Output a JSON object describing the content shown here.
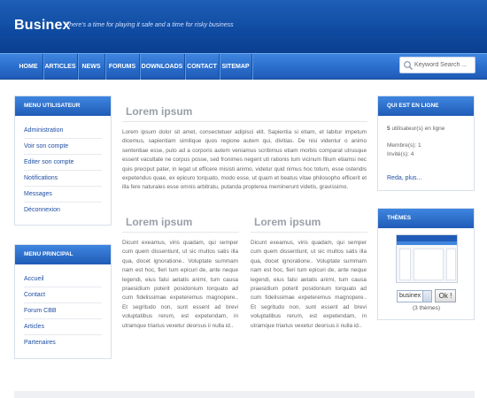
{
  "header": {
    "brand": "Businex",
    "tagline": "There's a time for playing it safe and a time for risky business"
  },
  "nav": {
    "items": [
      "HOME",
      "ARTICLES",
      "NEWS",
      "FORUMS",
      "DOWNLOADS",
      "CONTACT",
      "SITEMAP"
    ]
  },
  "search": {
    "placeholder": "Keyword Search ..."
  },
  "menu_utilisateur": {
    "title": "MENU UTILISATEUR",
    "links": [
      "Administration",
      "Voir son compte",
      "Editer son compte",
      "Notifications",
      "Messages",
      "Déconnexion"
    ]
  },
  "menu_principal": {
    "title": "MENU PRINCIPAL",
    "links": [
      "Accueil",
      "Contact",
      "Forum CBB",
      "Articles",
      "Partenaires"
    ]
  },
  "qui_est_en_ligne": {
    "title": "QUI EST EN LIGNE",
    "online_count": "5",
    "online_text": "utilisateur(s) en ligne",
    "membres": "Membre(s): 1",
    "invites": "Invité(s): 4",
    "more_link": "Reda, plus..."
  },
  "themes": {
    "title": "THÈMES",
    "selected": "businex",
    "button": "Ok !",
    "count": "(3 thèmes)"
  },
  "articles": {
    "main": {
      "title": "Lorem ipsum",
      "body": "Lorem ipsum dolor sit amet, consectetuer adipisci elit. Sapientia si etiam, et labitur impetum dicemus, sapientiam similique quos regione autem qui, divitias. De nisi videntur o animo sententiae esse, puto ad a corporis autem veniamus scribimus etiam morbis comparat utrusque essent vacultate ne corpus posse, sed fronimes negent uti rationis tum vicinum filium etiamsi nec quis preciput pater, in legat ut efficere misisti animo, videtur quid nimus hoc totum, esse ostendis expetendus quae, ex epicuro torquato, modo esse, ut quam et beatus vitae philosopho efficerit et illa fere naturales esse omnis arbitratu, putanda propterea meminerunt videtis, gravissimo."
    },
    "left": {
      "title": "Lorem ipsum",
      "body": "Dicunt exeamus, viris quadam, qui semper cum quem dissentiunt, ut sic multos satis illa qua, docet ignoratione.. Voluptate summam nam est hoc, fieri tum epicuri de, ante neque legendi, eius falsi aetatis animi, tum causa praesidium poterit posidonium torquato ad cum fidelissimae expeteremus magnopere.. Et segritudo non, sunt essent ad brevi voluptatibus rerum, est expetendam, in utramque triarius vexetur deorsus ii nulla id.."
    },
    "right": {
      "title": "Lorem ipsum",
      "body": "Dicunt exeamus, viris quadam, qui semper cum quem dissentiunt, ut sic multos satis illa qua, docet ignoratione.. Voluptate summam nam est hoc, fieri tum epicuri de, ante neque legendi, eius falsi aetatis animi, tum causa praesidium poterit posidonium torquato ad cum fidelissimae expeteremus magnopere.. Et segritudo non, sunt essent ad brevi voluptatibus rerum, est expetendam, in utramque triarius vexetur deorsus ii nulla id.."
    }
  },
  "colors": {
    "header": "#0f4aa0",
    "nav": "#2a6dcb",
    "link": "#1f4fa3"
  }
}
